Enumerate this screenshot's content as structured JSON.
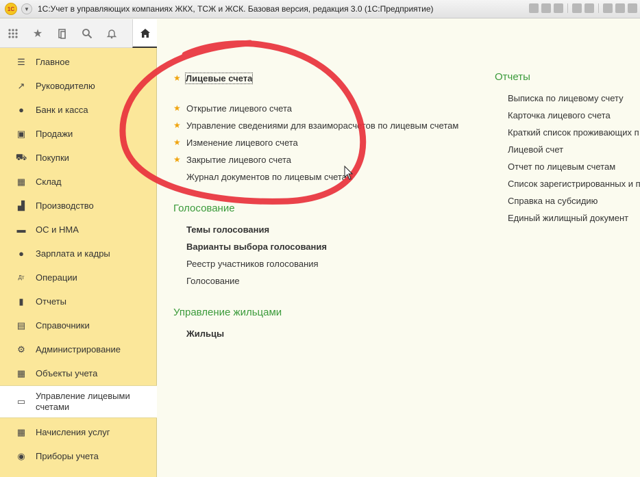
{
  "window": {
    "title": "1С:Учет в управляющих компаниях ЖКХ, ТСЖ и ЖСК. Базовая версия, редакция 3.0  (1С:Предприятие)",
    "logo_text": "1С"
  },
  "toolbar": {
    "icons": [
      "apps-grid-icon",
      "favorites-star-icon",
      "history-icon",
      "search-icon",
      "notifications-bell-icon"
    ],
    "home_icon": "home-icon"
  },
  "sidebar": {
    "items": [
      {
        "label": "Главное",
        "icon": "menu-lines-icon",
        "glyph": "☰"
      },
      {
        "label": "Руководителю",
        "icon": "trend-chart-icon",
        "glyph": "↗"
      },
      {
        "label": "Банк и касса",
        "icon": "ruble-coin-icon",
        "glyph": "●"
      },
      {
        "label": "Продажи",
        "icon": "shopping-bag-icon",
        "glyph": "▣"
      },
      {
        "label": "Покупки",
        "icon": "shopping-cart-icon",
        "glyph": "⛟"
      },
      {
        "label": "Склад",
        "icon": "warehouse-grid-icon",
        "glyph": "▦"
      },
      {
        "label": "Производство",
        "icon": "factory-icon",
        "glyph": "▟"
      },
      {
        "label": "ОС и НМА",
        "icon": "car-icon",
        "glyph": "▬"
      },
      {
        "label": "Зарплата и кадры",
        "icon": "person-icon",
        "glyph": "●"
      },
      {
        "label": "Операции",
        "icon": "debit-credit-icon",
        "glyph": "Дт"
      },
      {
        "label": "Отчеты",
        "icon": "bar-chart-icon",
        "glyph": "▮"
      },
      {
        "label": "Справочники",
        "icon": "books-icon",
        "glyph": "▤"
      },
      {
        "label": "Администрирование",
        "icon": "gear-icon",
        "glyph": "⚙"
      },
      {
        "label": "Объекты учета",
        "icon": "building-grid-icon",
        "glyph": "▦"
      },
      {
        "label": "Управление лицевыми счетами",
        "label_line1": "Управление лицевыми",
        "label_line2": "счетами",
        "icon": "id-card-icon",
        "glyph": "▭",
        "active": true
      },
      {
        "label": "Начисления услуг",
        "icon": "calculator-icon",
        "glyph": "▦"
      },
      {
        "label": "Приборы учета",
        "icon": "meter-dial-icon",
        "glyph": "◉"
      }
    ]
  },
  "main": {
    "accounts": {
      "head_link": "Лицевые счета",
      "items": [
        {
          "label": "Открытие лицевого счета",
          "starred": true
        },
        {
          "label": "Управление сведениями для взаиморасчетов по лицевым счетам",
          "starred": true
        },
        {
          "label": "Изменение лицевого счета",
          "starred": true
        },
        {
          "label": "Закрытие лицевого счета",
          "starred": true
        },
        {
          "label": "Журнал документов по лицевым счетам",
          "starred": false
        }
      ]
    },
    "voting": {
      "title": "Голосование",
      "items": [
        {
          "label": "Темы голосования",
          "bold": true
        },
        {
          "label": "Варианты выбора голосования",
          "bold": true
        },
        {
          "label": "Реестр участников голосования",
          "bold": false
        },
        {
          "label": "Голосование",
          "bold": false
        }
      ]
    },
    "residents": {
      "title": "Управление жильцами",
      "items": [
        {
          "label": "Жильцы",
          "bold": true
        }
      ]
    },
    "reports": {
      "title": "Отчеты",
      "items": [
        "Выписка по лицевому счету",
        "Карточка лицевого счета",
        "Краткий список проживающих п",
        "Лицевой счет",
        "Отчет по лицевым счетам",
        "Список зарегистрированных и п",
        "Справка на субсидию",
        "Единый жилищный документ"
      ]
    }
  },
  "colors": {
    "sidebar_bg": "#fbe79a",
    "main_bg": "#fbfbef",
    "section_green": "#3a9a3a",
    "star": "#f0a40e",
    "annotation_red": "#e8323c"
  }
}
